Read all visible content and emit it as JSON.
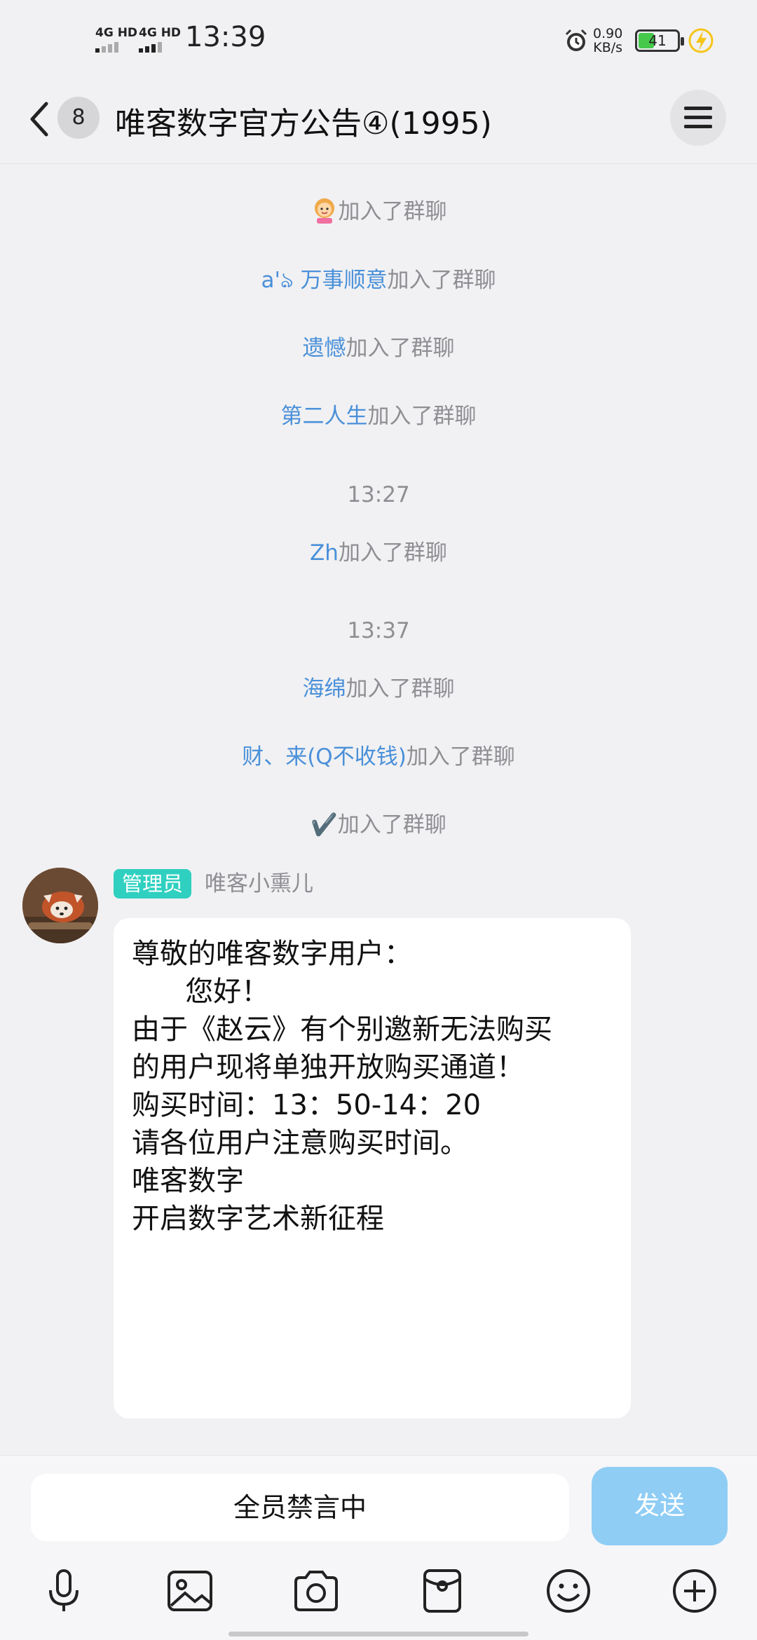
{
  "status_bar": {
    "time": "13:39",
    "signal1_label": "4G HD",
    "signal2_label": "4G HD",
    "net_speed_value": "0.90",
    "net_speed_unit": "KB/s",
    "battery_level": "41"
  },
  "header": {
    "unread_count": "8",
    "title": "唯客数字官方公告④(1995)"
  },
  "system_messages": [
    {
      "who": "",
      "action": "加入了群聊"
    },
    {
      "who": "a'ঌ 万事顺意",
      "action": "加入了群聊"
    },
    {
      "who": "遗憾",
      "action": "加入了群聊"
    },
    {
      "who": "第二人生",
      "action": "加入了群聊"
    },
    {
      "timestamp": "13:27"
    },
    {
      "who": "Zh",
      "action": "加入了群聊"
    },
    {
      "timestamp": "13:37"
    },
    {
      "who": "海绵",
      "action": "加入了群聊"
    },
    {
      "who": "财、来(Q不收钱)",
      "action": "加入了群聊"
    },
    {
      "who": "✔️",
      "action": "加入了群聊"
    }
  ],
  "message": {
    "role": "管理员",
    "sender": "唯客小熏儿",
    "lines": [
      "尊敬的唯客数字用户：",
      "      您好！",
      "",
      "由于《赵云》有个别邀新无法购买",
      "的用户现将单独开放购买通道！",
      "购买时间：13：50-14：20",
      "",
      "请各位用户注意购买时间。",
      "",
      "",
      "唯客数字",
      "开启数字艺术新征程"
    ]
  },
  "input": {
    "muted_text": "全员禁言中",
    "send_label": "发送"
  },
  "toolbar_icons": [
    "microphone-icon",
    "image-icon",
    "camera-icon",
    "red-packet-icon",
    "emoji-icon",
    "plus-icon"
  ]
}
